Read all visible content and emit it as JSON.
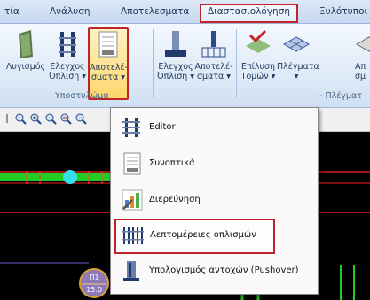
{
  "menu": {
    "tabs": [
      "τία",
      "Ανάλυση",
      "Αποτελεσματα",
      "Διαστασιολόγηση",
      "Ξυλότυποι"
    ],
    "active_tab": "Διαστασιολόγηση"
  },
  "ribbon": {
    "tools": [
      {
        "line1": "Λυγισμός",
        "line2": ""
      },
      {
        "line1": "Ελεγχος",
        "line2": "Όπλιση ▾"
      },
      {
        "line1": "Αποτελέ-",
        "line2": "σματα ▾"
      },
      {
        "line1": "Ελεγχος",
        "line2": "Όπλιση ▾"
      },
      {
        "line1": "Αποτελέ-",
        "line2": "σματα ▾"
      },
      {
        "line1": "Επίλυση",
        "line2": "Τομών ▾"
      },
      {
        "line1": "Πλέγματα",
        "line2": "▾"
      },
      {
        "line1": "Απ",
        "line2": "σμ"
      }
    ],
    "groups": [
      "Υποστυλώμα",
      "- Πλέγματ"
    ]
  },
  "dropdown": {
    "items": [
      {
        "label": "Editor"
      },
      {
        "label": "Συνοπτικά"
      },
      {
        "label": "Διερεύνηση"
      },
      {
        "label": "Λεπτομέρειες οπλισμών"
      },
      {
        "label": "Υπολογισμός αντοχών (Pushover)"
      }
    ]
  },
  "canvas": {
    "node_label": "Π1",
    "node_value": "15.0"
  },
  "colors": {
    "highlight_border": "#c0242a",
    "selected_fill": "#ffd66b",
    "canvas_bg": "#000000",
    "beam_green": "#22cc22",
    "beam_red": "#ff2020"
  }
}
